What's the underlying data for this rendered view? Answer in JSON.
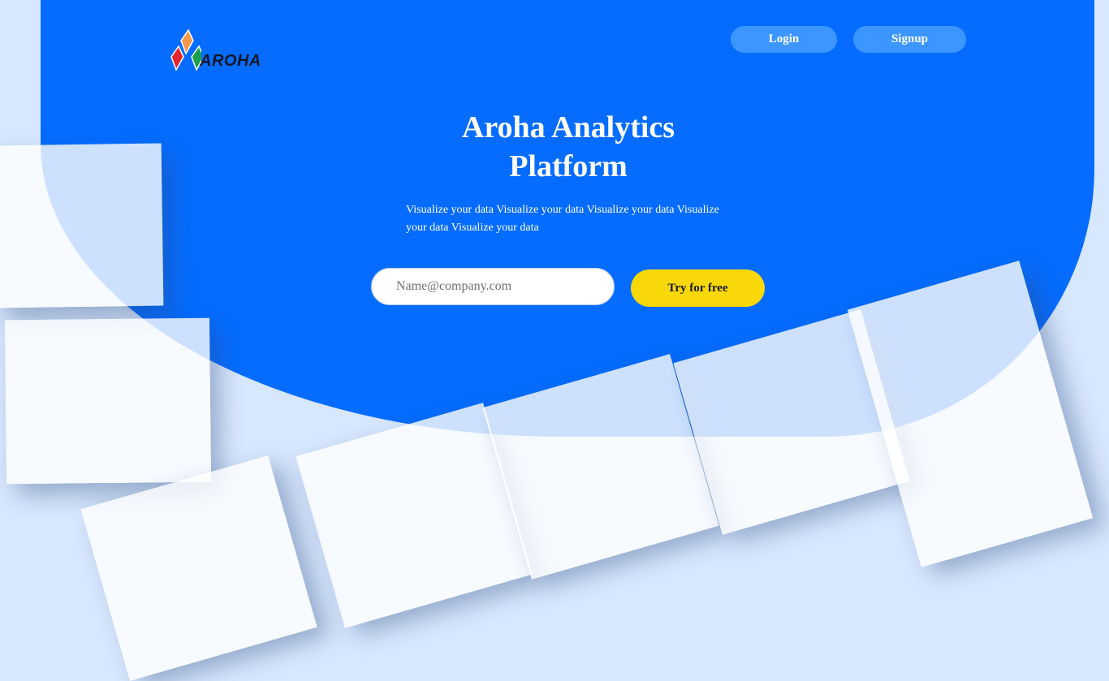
{
  "brand": {
    "name": "Aroha",
    "logo_text": "AROHA"
  },
  "nav": {
    "login_label": "Login",
    "signup_label": "Signup"
  },
  "hero": {
    "title_line1": "Aroha Analytics",
    "title_line2": "Platform",
    "description": "Visualize your data Visualize your data Visualize your data Visualize your data Visualize your data"
  },
  "signup_form": {
    "email_placeholder": "Name@company.com",
    "email_value": "",
    "cta_label": "Try for free"
  },
  "colors": {
    "hero_blue": "#056cff",
    "page_background": "#d7e7fd",
    "nav_button": "#3c96ff",
    "cta_yellow": "#f9d80a"
  }
}
